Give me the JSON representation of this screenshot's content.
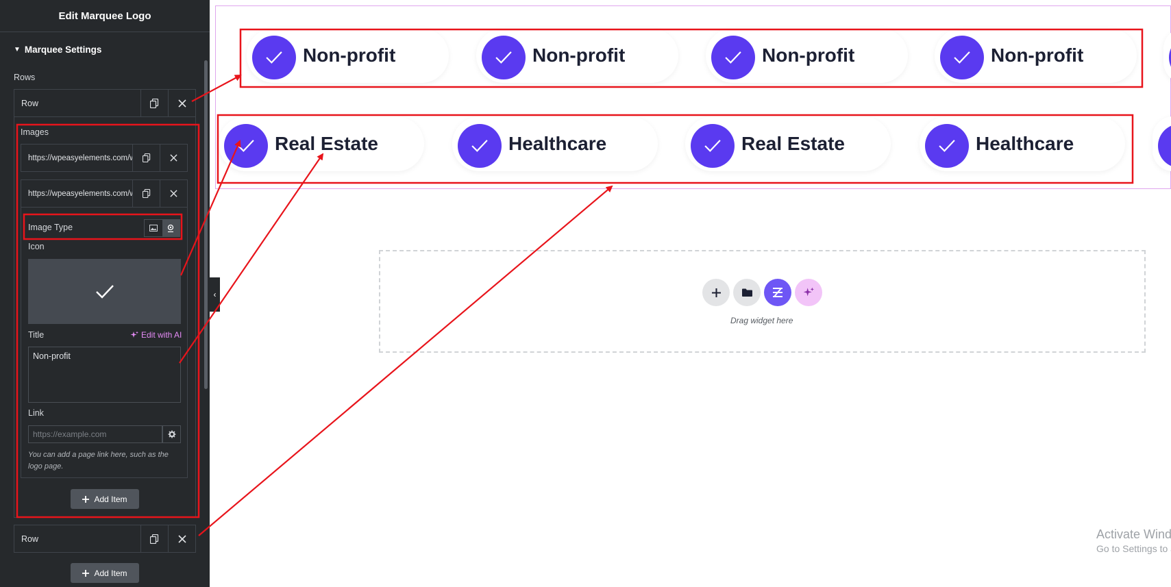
{
  "sidebar": {
    "header_title": "Edit Marquee Logo",
    "section_title": "Marquee Settings",
    "rows_label": "Rows",
    "row1_title": "Row",
    "row2_title": "Row",
    "images_label": "Images",
    "image_items": [
      {
        "url": "https://wpeasyelements.com/wp-content"
      },
      {
        "url": "https://wpeasyelements.com/wp-content"
      }
    ],
    "image_type_label": "Image Type",
    "icon_label": "Icon",
    "title_label": "Title",
    "edit_ai_label": "Edit with AI",
    "title_value": "Non-profit",
    "link_label": "Link",
    "link_placeholder": "https://example.com",
    "help_text": "You can add a page link here, such as the logo page.",
    "add_item_inner": "Add Item",
    "add_item_outer": "Add Item"
  },
  "canvas": {
    "row1_items": [
      "Non-profit",
      "Non-profit",
      "Non-profit",
      "Non-profit"
    ],
    "row2_items": [
      "Real Estate",
      "Healthcare",
      "Real Estate",
      "Healthcare"
    ],
    "drag_text": "Drag widget here"
  },
  "watermark": {
    "line1": "Activate Windows",
    "line2": "Go to Settings to activate Windows."
  },
  "colors": {
    "accent": "#5a3af0",
    "annotation": "#e8141b",
    "sidebar_bg": "#26292c",
    "ai_pink": "#e48bf5"
  },
  "icons": [
    "duplicate-icon",
    "close-icon",
    "image-icon",
    "icon-library-icon",
    "check-icon",
    "gear-icon",
    "plus-icon",
    "folder-icon",
    "elementor-kit-icon",
    "ai-sparkle-icon",
    "chevron-left-icon"
  ]
}
